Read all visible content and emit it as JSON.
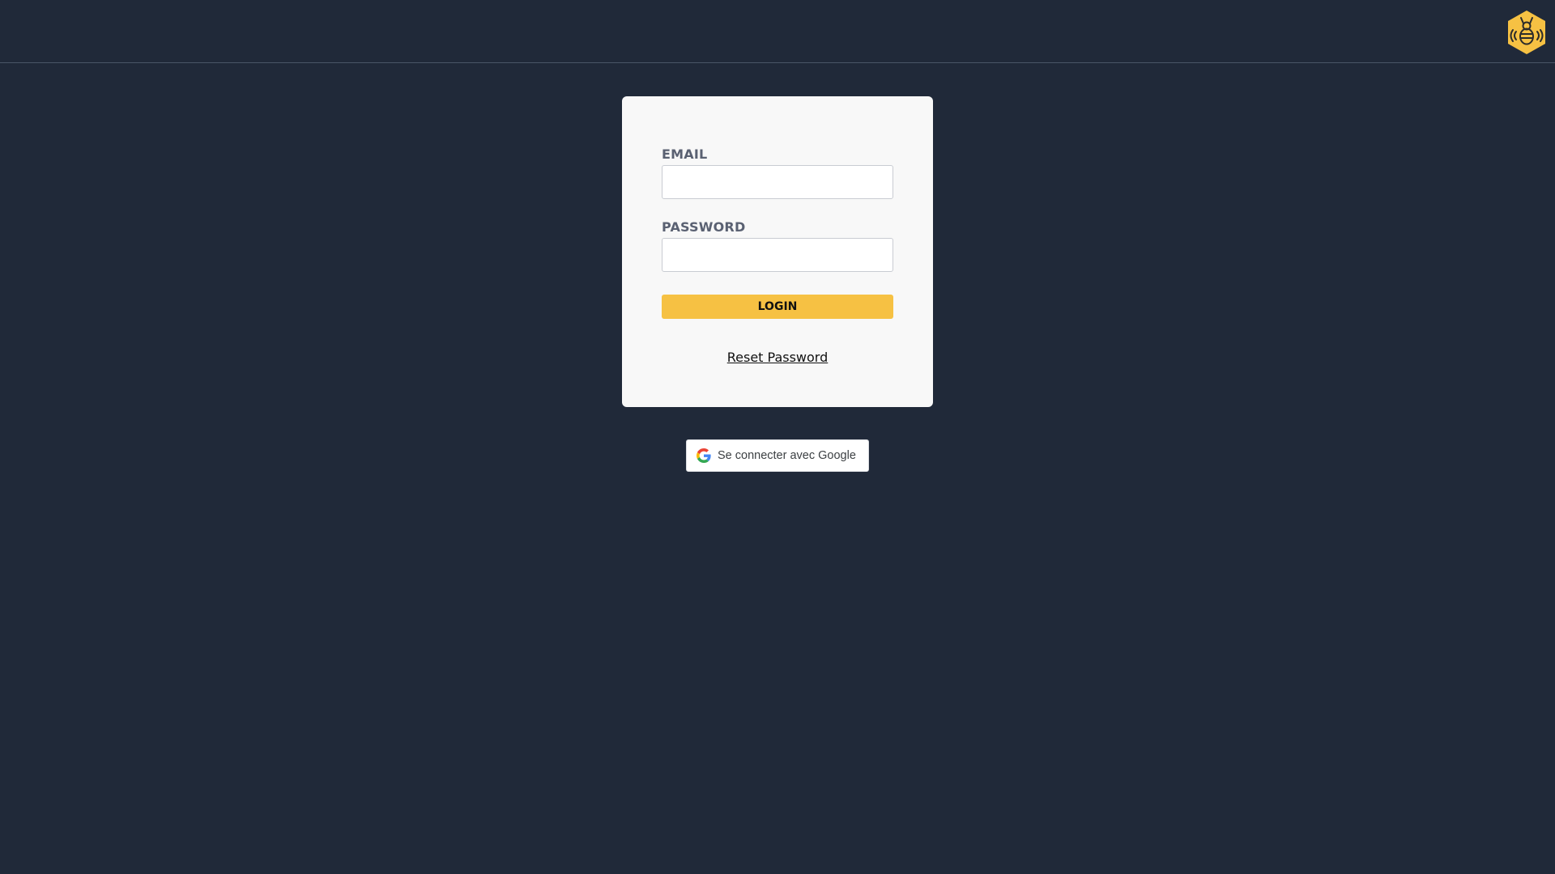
{
  "header": {
    "logo_icon": "bee-hexagon-icon",
    "logo_color": "#f6c143"
  },
  "login_form": {
    "email_label": "EMAIL",
    "email_value": "",
    "password_label": "PASSWORD",
    "password_value": "",
    "login_label": "LOGIN",
    "reset_label": "Reset Password"
  },
  "google_signin": {
    "label": "Se connecter avec Google",
    "icon": "google-g-icon"
  },
  "colors": {
    "background": "#202939",
    "card": "#f8f8f8",
    "accent": "#f6c143"
  }
}
